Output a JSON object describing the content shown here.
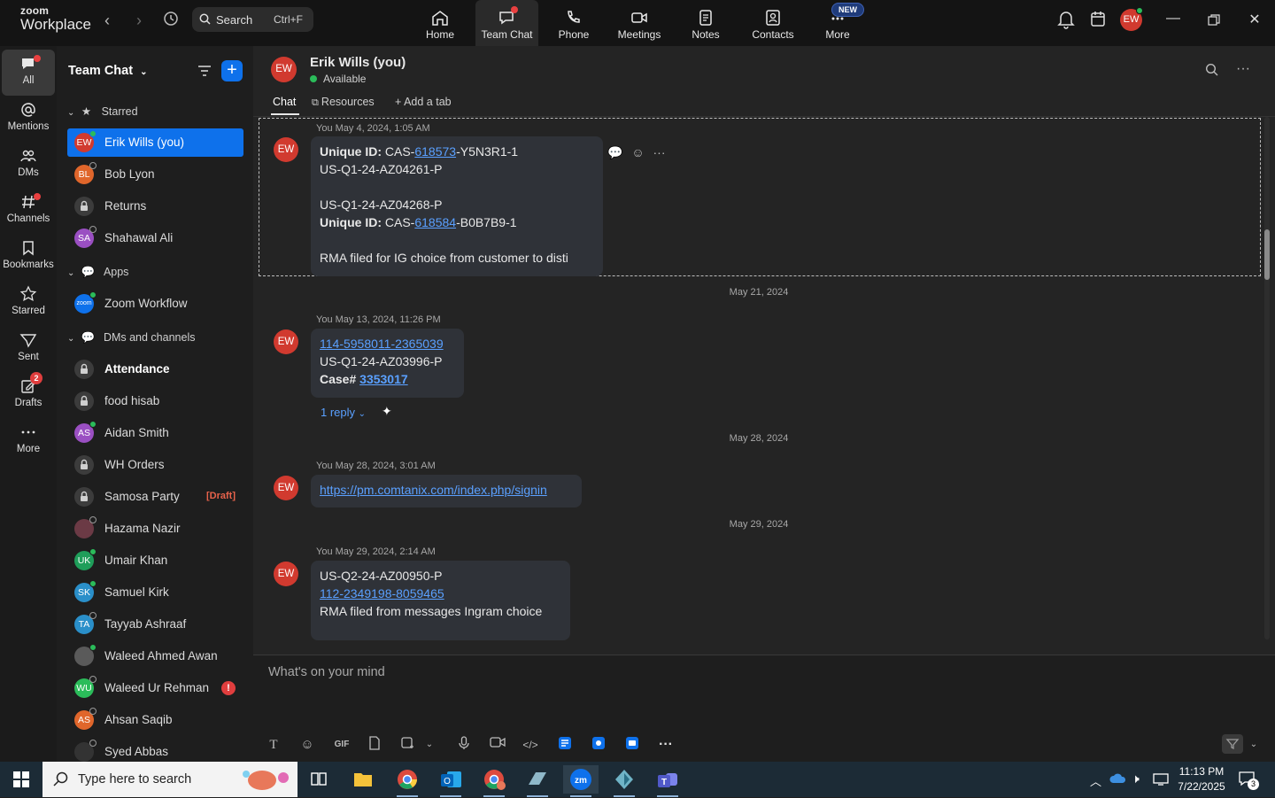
{
  "app": {
    "logo_line1": "zoom",
    "logo_line2": "Workplace",
    "search_label": "Search",
    "search_shortcut": "Ctrl+F"
  },
  "top_tabs": [
    {
      "label": "Home",
      "icon": "home-icon"
    },
    {
      "label": "Team Chat",
      "icon": "chat-icon"
    },
    {
      "label": "Phone",
      "icon": "phone-icon"
    },
    {
      "label": "Meetings",
      "icon": "video-icon"
    },
    {
      "label": "Notes",
      "icon": "notes-icon"
    },
    {
      "label": "Contacts",
      "icon": "contacts-icon"
    },
    {
      "label": "More",
      "icon": "more-icon"
    }
  ],
  "new_badge": "NEW",
  "user_initials": "EW",
  "rail": [
    {
      "label": "All"
    },
    {
      "label": "Mentions"
    },
    {
      "label": "DMs"
    },
    {
      "label": "Channels"
    },
    {
      "label": "Bookmarks"
    },
    {
      "label": "Starred"
    },
    {
      "label": "Sent"
    },
    {
      "label": "Drafts",
      "badge": "2"
    },
    {
      "label": "More"
    }
  ],
  "sidebar": {
    "title": "Team Chat",
    "sections": {
      "starred": "Starred",
      "apps": "Apps",
      "dms": "DMs and channels"
    },
    "starred_items": [
      {
        "name": "Erik Wills (you)",
        "initials": "EW",
        "color": "#d13a2f"
      },
      {
        "name": "Bob Lyon",
        "initials": "BL",
        "color": "#e0662b"
      },
      {
        "name": "Returns",
        "initials": "",
        "color": ""
      },
      {
        "name": "Shahawal Ali",
        "initials": "SA",
        "color": "#9a4fc2"
      }
    ],
    "app_items": [
      {
        "name": "Zoom Workflow",
        "initials": "zoom",
        "color": "#0e71eb"
      }
    ],
    "dm_items": [
      {
        "name": "Attendance",
        "initials": "",
        "color": ""
      },
      {
        "name": "food hisab",
        "initials": "",
        "color": ""
      },
      {
        "name": "Aidan Smith",
        "initials": "AS",
        "color": "#9a4fc2"
      },
      {
        "name": "WH Orders",
        "initials": "",
        "color": ""
      },
      {
        "name": "Samosa Party",
        "initials": "",
        "color": "",
        "tag": "[Draft]"
      },
      {
        "name": "Hazama Nazir",
        "initials": "",
        "color": "#6b3a45"
      },
      {
        "name": "Umair Khan",
        "initials": "UK",
        "color": "#1f9e5a"
      },
      {
        "name": "Samuel Kirk",
        "initials": "SK",
        "color": "#2a8fc9"
      },
      {
        "name": "Tayyab Ashraaf",
        "initials": "TA",
        "color": "#2a8fc9"
      },
      {
        "name": "Waleed Ahmed Awan",
        "initials": "",
        "color": "#5a5a5a"
      },
      {
        "name": "Waleed Ur Rehman",
        "initials": "WU",
        "color": "#2bbc5a",
        "alert": "!"
      },
      {
        "name": "Ahsan Saqib",
        "initials": "AS",
        "color": "#e0662b"
      },
      {
        "name": "Syed Abbas",
        "initials": "",
        "color": "#333333"
      }
    ]
  },
  "chat": {
    "header_name": "Erik Wills (you)",
    "header_initials": "EW",
    "status": "Available",
    "tabs": [
      "Chat",
      "Resources",
      "Add a tab"
    ],
    "messages": [
      {
        "meta": "You May 4, 2024, 1:05 AM",
        "line1_bold": "Unique ID:",
        "line1_pre": " CAS-",
        "line1_link": "618573",
        "line1_post": "-Y5N3R1-1",
        "line2": "US-Q1-24-AZ04261-P",
        "line3": "US-Q1-24-AZ04268-P",
        "line4_bold": "Unique ID:",
        "line4_pre": " CAS-",
        "line4_link": "618584",
        "line4_post": "-B0B7B9-1",
        "line5": "RMA filed for IG choice from customer to disti"
      },
      {
        "date": "May 21, 2024",
        "meta": "You May 13, 2024, 11:26 PM",
        "link1": "114-5958011-2365039",
        "line2": "US-Q1-24-AZ03996-P",
        "case_label": "Case#",
        "case_link": "3353017",
        "reply": "1 reply"
      },
      {
        "date": "May 28, 2024",
        "meta": "You May 28, 2024, 3:01 AM",
        "link": "https://pm.comtanix.com/index.php/signin"
      },
      {
        "date": "May 29, 2024",
        "meta": "You May 29, 2024, 2:14 AM",
        "line1": "US-Q2-24-AZ00950-P",
        "link": "112-2349198-8059465",
        "line3": "RMA filed from messages Ingram choice"
      }
    ],
    "composer_placeholder": "What's on your mind",
    "composer_tools": [
      "T",
      "☺",
      "GIF"
    ]
  },
  "taskbar": {
    "search_placeholder": "Type here to search",
    "time": "11:13 PM",
    "date": "7/22/2025",
    "notif_count": "3"
  },
  "colors": {
    "accent": "#0e71eb",
    "link": "#5aa0ff",
    "avatar_red": "#d13a2f",
    "presence": "#2bbc5a"
  }
}
